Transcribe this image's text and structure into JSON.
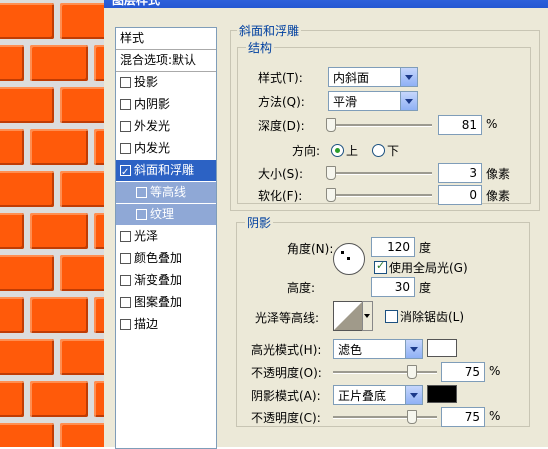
{
  "dialog": {
    "title": "图层样式"
  },
  "style_list": {
    "header": "样式",
    "blend_options": "混合选项:默认",
    "items": [
      {
        "label": "投影",
        "checked": false
      },
      {
        "label": "内阴影",
        "checked": false
      },
      {
        "label": "外发光",
        "checked": false
      },
      {
        "label": "内发光",
        "checked": false
      },
      {
        "label": "斜面和浮雕",
        "checked": true
      },
      {
        "label": "等高线",
        "checked": false
      },
      {
        "label": "纹理",
        "checked": false
      },
      {
        "label": "光泽",
        "checked": false
      },
      {
        "label": "颜色叠加",
        "checked": false
      },
      {
        "label": "渐变叠加",
        "checked": false
      },
      {
        "label": "图案叠加",
        "checked": false
      },
      {
        "label": "描边",
        "checked": false
      }
    ]
  },
  "bevel": {
    "section_title": "斜面和浮雕",
    "structure": {
      "title": "结构",
      "style_label": "样式(T):",
      "style_value": "内斜面",
      "technique_label": "方法(Q):",
      "technique_value": "平滑",
      "depth_label": "深度(D):",
      "depth_value": "81",
      "depth_unit": "%",
      "direction_label": "方向:",
      "direction_up": "上",
      "direction_down": "下",
      "direction_selected": "上",
      "size_label": "大小(S):",
      "size_value": "3",
      "size_unit": "像素",
      "soften_label": "软化(F):",
      "soften_value": "0",
      "soften_unit": "像素"
    },
    "shading": {
      "title": "阴影",
      "angle_label": "角度(N):",
      "angle_value": "120",
      "angle_unit": "度",
      "global_light_label": "使用全局光(G)",
      "global_light": true,
      "altitude_label": "高度:",
      "altitude_value": "30",
      "altitude_unit": "度",
      "gloss_contour_label": "光泽等高线:",
      "anti_aliased_label": "消除锯齿(L)",
      "anti_aliased": false,
      "highlight_mode_label": "高光模式(H):",
      "highlight_mode_value": "滤色",
      "highlight_color": "#ffffff",
      "highlight_opacity_label": "不透明度(O):",
      "highlight_opacity_value": "75",
      "highlight_opacity_unit": "%",
      "shadow_mode_label": "阴影模式(A):",
      "shadow_mode_value": "正片叠底",
      "shadow_color": "#000000",
      "shadow_opacity_label": "不透明度(C):",
      "shadow_opacity_value": "75",
      "shadow_opacity_unit": "%"
    }
  }
}
